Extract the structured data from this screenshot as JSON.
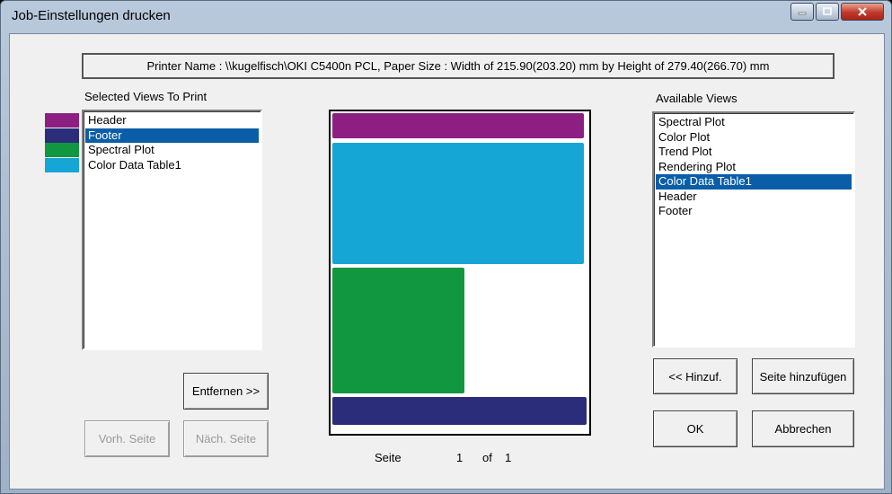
{
  "window": {
    "title": "Job-Einstellungen drucken",
    "minimize_icon": "minimize-icon",
    "maximize_icon": "maximize-icon",
    "close_icon": "close-icon"
  },
  "printer_info": "Printer Name : \\\\kugelfisch\\OKI C5400n PCL, Paper Size : Width of 215.90(203.20) mm by Height of 279.40(266.70) mm",
  "selected_views": {
    "label": "Selected Views To Print",
    "items": [
      {
        "label": "Header",
        "color": "#8e1f82",
        "selected": false
      },
      {
        "label": "Footer",
        "color": "#2b2d7a",
        "selected": true
      },
      {
        "label": "Spectral Plot",
        "color": "#11973f",
        "selected": false
      },
      {
        "label": "Color Data Table1",
        "color": "#15a6d6",
        "selected": false
      }
    ]
  },
  "available_views": {
    "label": "Available Views",
    "items": [
      {
        "label": "Spectral Plot",
        "selected": false
      },
      {
        "label": "Color Plot",
        "selected": false
      },
      {
        "label": "Trend Plot",
        "selected": false
      },
      {
        "label": "Rendering Plot",
        "selected": false
      },
      {
        "label": "Color Data Table1",
        "selected": true
      },
      {
        "label": "Header",
        "selected": false
      },
      {
        "label": "Footer",
        "selected": false
      }
    ]
  },
  "preview_colors": {
    "header": "#8e1f82",
    "table": "#15a6d6",
    "spectral": "#11973f",
    "footer": "#2b2d7a"
  },
  "buttons": {
    "remove": "Entfernen >>",
    "prev_page": "Vorh. Seite",
    "next_page": "Näch. Seite",
    "add": "<< Hinzuf.",
    "add_page": "Seite hinzufügen",
    "ok": "OK",
    "cancel": "Abbrechen"
  },
  "pagination": {
    "page_label": "Seite",
    "current": "1",
    "of_label": "of",
    "total": "1"
  }
}
